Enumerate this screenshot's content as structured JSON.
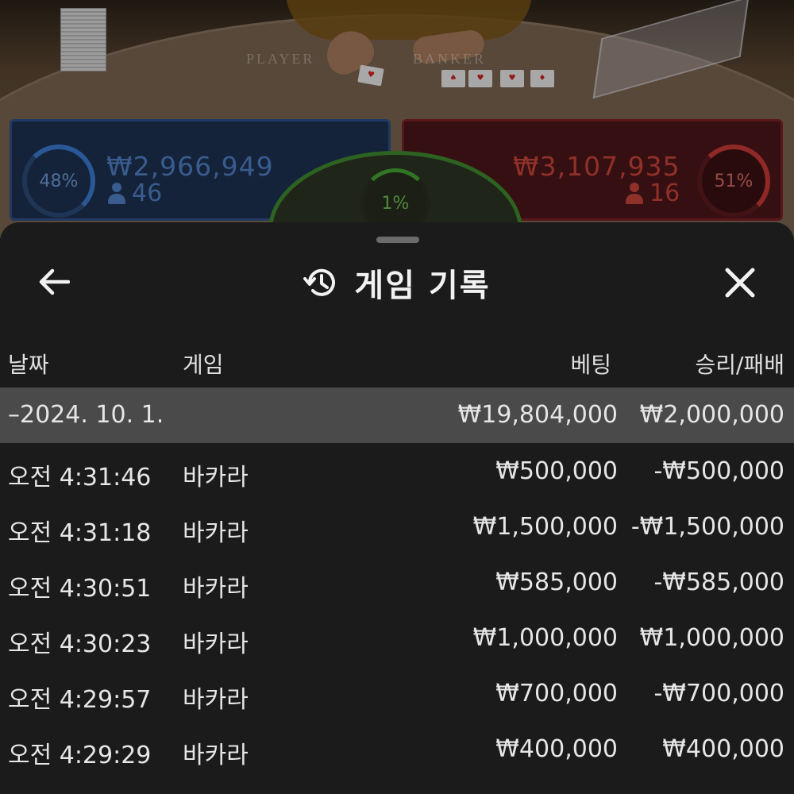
{
  "game": {
    "player_label": "PLAYER",
    "banker_label": "BANKER",
    "player_pct": "48%",
    "player_amount": "₩2,966,949",
    "player_count": "46",
    "banker_pct": "51%",
    "banker_amount": "₩3,107,935",
    "banker_count": "16",
    "tie_pct": "1%"
  },
  "sheet": {
    "title": "게임 기록",
    "icons": {
      "back": "arrow-left-icon",
      "history": "history-icon",
      "close": "close-icon"
    }
  },
  "columns": {
    "date": "날짜",
    "game": "게임",
    "bet": "베팅",
    "result": "승리/패배"
  },
  "summary": {
    "date": "–2024. 10. 1.",
    "bet": "₩19,804,000",
    "result": "₩2,000,000"
  },
  "rows": [
    {
      "time": "오전 4:31:46",
      "game": "바카라",
      "bet": "₩500,000",
      "result": "-₩500,000"
    },
    {
      "time": "오전 4:31:18",
      "game": "바카라",
      "bet": "₩1,500,000",
      "result": "-₩1,500,000"
    },
    {
      "time": "오전 4:30:51",
      "game": "바카라",
      "bet": "₩585,000",
      "result": "-₩585,000"
    },
    {
      "time": "오전 4:30:23",
      "game": "바카라",
      "bet": "₩1,000,000",
      "result": "₩1,000,000"
    },
    {
      "time": "오전 4:29:57",
      "game": "바카라",
      "bet": "₩700,000",
      "result": "-₩700,000"
    },
    {
      "time": "오전 4:29:29",
      "game": "바카라",
      "bet": "₩400,000",
      "result": "₩400,000"
    }
  ],
  "colors": {
    "player": "#3b7ad2",
    "banker": "#c83a34",
    "tie": "#45a234",
    "sheet_bg": "#1b1b1b",
    "summary_bg": "#4a4a4a"
  }
}
